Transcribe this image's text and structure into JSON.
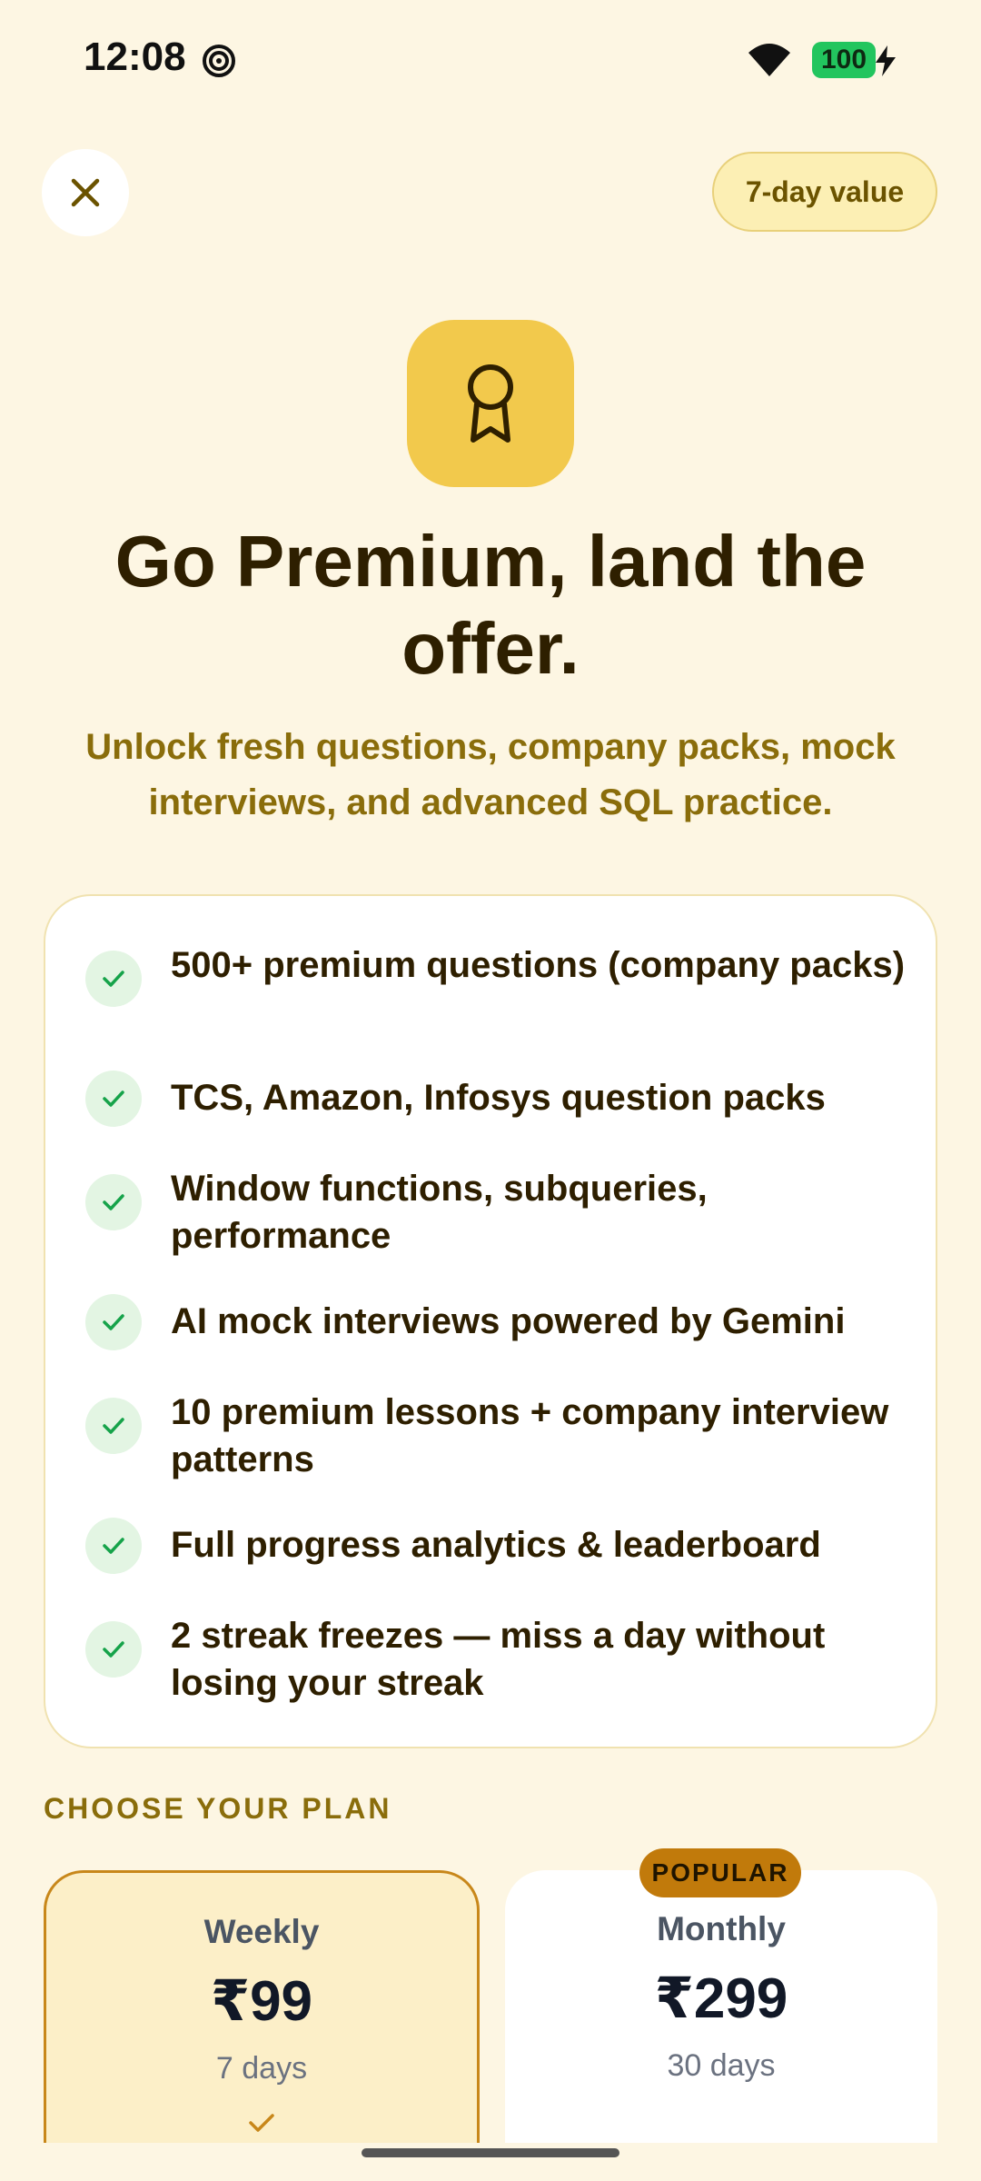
{
  "status_bar": {
    "time": "12:08",
    "battery": "100"
  },
  "header": {
    "value_pill": "7-day value"
  },
  "hero": {
    "title": "Go Premium, land the offer.",
    "subtitle": "Unlock fresh questions, company packs, mock interviews, and advanced SQL practice."
  },
  "features": [
    "500+ premium questions (company packs)",
    "TCS, Amazon, Infosys question packs",
    "Window functions, subqueries, performance",
    "AI mock interviews powered by Gemini",
    "10 premium lessons + company interview patterns",
    "Full progress analytics & leaderboard",
    "2 streak freezes — miss a day without losing your streak"
  ],
  "plans_section": {
    "label": "CHOOSE YOUR PLAN",
    "plans": [
      {
        "name": "Weekly",
        "price": "₹99",
        "duration": "7 days",
        "selected": true
      },
      {
        "name": "Monthly",
        "price": "₹299",
        "duration": "30 days",
        "badge": "POPULAR",
        "selected": false
      }
    ]
  },
  "colors": {
    "background": "#FDF6E3",
    "accent": "#F2C94C",
    "check_green": "#16A34A",
    "badge": "#C17A0B"
  }
}
